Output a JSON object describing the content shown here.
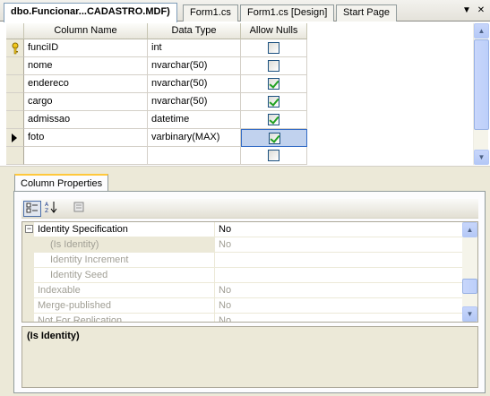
{
  "tabs": [
    {
      "label": "dbo.Funcionar...CADASTRO.MDF)",
      "active": true
    },
    {
      "label": "Form1.cs",
      "active": false
    },
    {
      "label": "Form1.cs [Design]",
      "active": false
    },
    {
      "label": "Start Page",
      "active": false
    }
  ],
  "tab_controls": {
    "dropdown": "▼",
    "close": "✕"
  },
  "grid": {
    "headers": [
      "Column Name",
      "Data Type",
      "Allow Nulls"
    ],
    "rows": [
      {
        "name": "funciID",
        "type": "int",
        "allow_nulls": false,
        "marker": "key-icon"
      },
      {
        "name": "nome",
        "type": "nvarchar(50)",
        "allow_nulls": false
      },
      {
        "name": "endereco",
        "type": "nvarchar(50)",
        "allow_nulls": true
      },
      {
        "name": "cargo",
        "type": "nvarchar(50)",
        "allow_nulls": true
      },
      {
        "name": "admissao",
        "type": "datetime",
        "allow_nulls": true
      },
      {
        "name": "foto",
        "type": "varbinary(MAX)",
        "allow_nulls": true,
        "marker": "current-row-arrow-icon",
        "selected": true
      },
      {
        "name": "",
        "type": "",
        "allow_nulls": false
      }
    ]
  },
  "properties": {
    "tab_label": "Column Properties",
    "toolbar_icons": [
      "categorized-icon",
      "alphabetical-icon",
      "property-pages-icon"
    ],
    "rows": [
      {
        "name": "Identity Specification",
        "value": "No",
        "expanded": true,
        "dim": false,
        "indent": false
      },
      {
        "name": "(Is Identity)",
        "value": "No",
        "dim": true,
        "indent": true,
        "selected": true
      },
      {
        "name": "Identity Increment",
        "value": "",
        "dim": true,
        "indent": true
      },
      {
        "name": "Identity Seed",
        "value": "",
        "dim": true,
        "indent": true
      },
      {
        "name": "Indexable",
        "value": "No",
        "dim": true,
        "indent": false
      },
      {
        "name": "Merge-published",
        "value": "No",
        "dim": true,
        "indent": false
      },
      {
        "name": "Not For Replication",
        "value": "No",
        "dim": true,
        "indent": false
      }
    ],
    "description_title": "(Is Identity)"
  },
  "colors": {
    "accent_tab": "#ffc83c",
    "selection": "#c1d2ee",
    "check": "#21a121"
  }
}
